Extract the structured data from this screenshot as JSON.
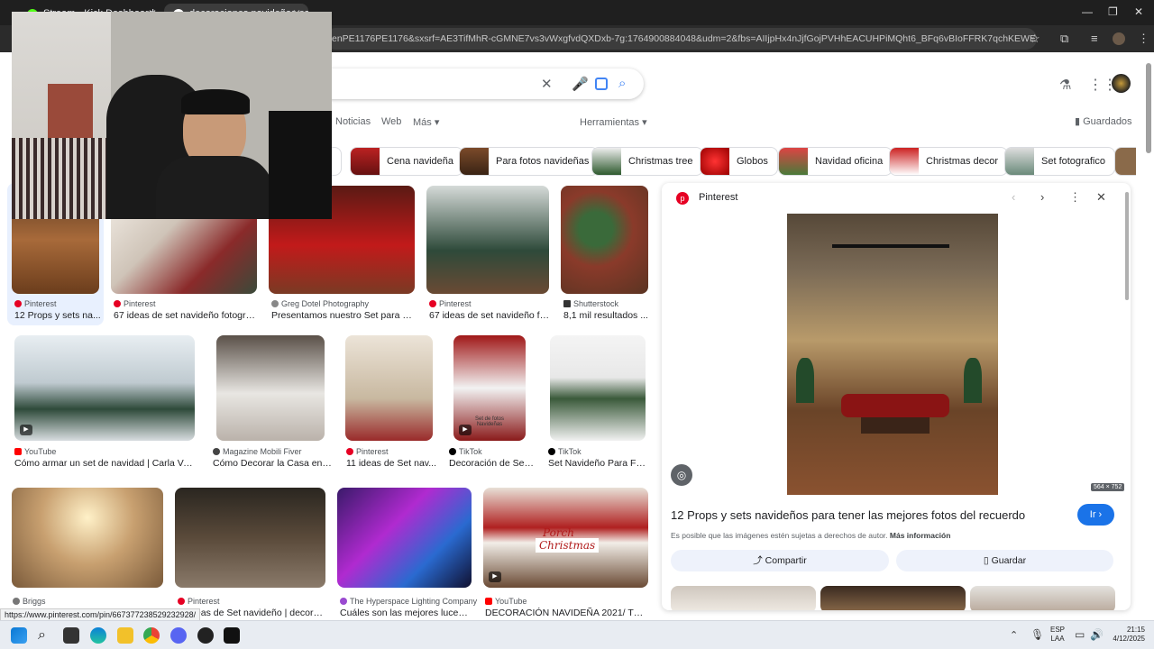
{
  "browser": {
    "tab1": "Stream - Kick Dashboard",
    "tab2": "decoraciones navideñas estud",
    "url": "enPE1176PE1176&sxsrf=AE3TifMhR-cGMNE7vs3vWxgfvdQXDxb-7g:1764900884048&udm=2&fbs=AIIjpHx4nJjfGojPVHhEACUHPiMQht6_BFq6vBIoFFRK7qchKEWEvuc0Hbw31oEI7c8o3..."
  },
  "header": {
    "tabs": [
      "Noticias",
      "Web",
      "Más"
    ],
    "tools": "Herramientas",
    "saved": "Guardados"
  },
  "chips": [
    "s",
    "Cena navideña",
    "Para fotos navideñas",
    "Christmas tree",
    "Globos",
    "Navidad oficina",
    "Christmas decor",
    "Set fotografico"
  ],
  "results": [
    {
      "src": "Pinterest",
      "title": "12 Props y sets na..."
    },
    {
      "src": "Pinterest",
      "title": "67 ideas de set navideño fotografi..."
    },
    {
      "src": "Greg Dotel Photography",
      "title": "Presentamos nuestro Set para se..."
    },
    {
      "src": "Pinterest",
      "title": "67 ideas de set navideño fot..."
    },
    {
      "src": "Shutterstock",
      "title": "8,1 mil resultados ..."
    },
    {
      "src": "YouTube",
      "title": "Cómo armar un set de navidad | Carla Vera ..."
    },
    {
      "src": "Magazine Mobili Fiver",
      "title": "Cómo Decorar la Casa en N..."
    },
    {
      "src": "Pinterest",
      "title": "11 ideas de Set nav..."
    },
    {
      "src": "TikTok",
      "title": "Decoración de Set ..."
    },
    {
      "src": "TikTok",
      "title": "Set Navideño Para Fot..."
    },
    {
      "src": "Briggs",
      "title": ""
    },
    {
      "src": "Pinterest",
      "title": "1 ideas de Set navideño | decoraci..."
    },
    {
      "src": "The Hyperspace Lighting Company",
      "title": "Cuáles son las mejores luces d..."
    },
    {
      "src": "YouTube",
      "title": "DECORACIÓN NAVIDEÑA 2021/ TEN..."
    }
  ],
  "thumb_texts": {
    "tiktok1": "Set de fotos Navideñas",
    "porch1": "Porch",
    "porch2": "Christmas"
  },
  "panel": {
    "source": "Pinterest",
    "size": "564 × 752",
    "title": "12 Props y sets navideños para tener las mejores fotos del recuerdo",
    "go": "Ir",
    "notice": "Es posible que las imágenes estén sujetas a derechos de autor.",
    "more": "Más información",
    "share": "Compartir",
    "save": "Guardar"
  },
  "status_url": "https://www.pinterest.com/pin/667377238529232928/",
  "taskbar": {
    "lang1": "ESP",
    "lang2": "LAA",
    "time": "21:15",
    "date": "4/12/2025"
  }
}
